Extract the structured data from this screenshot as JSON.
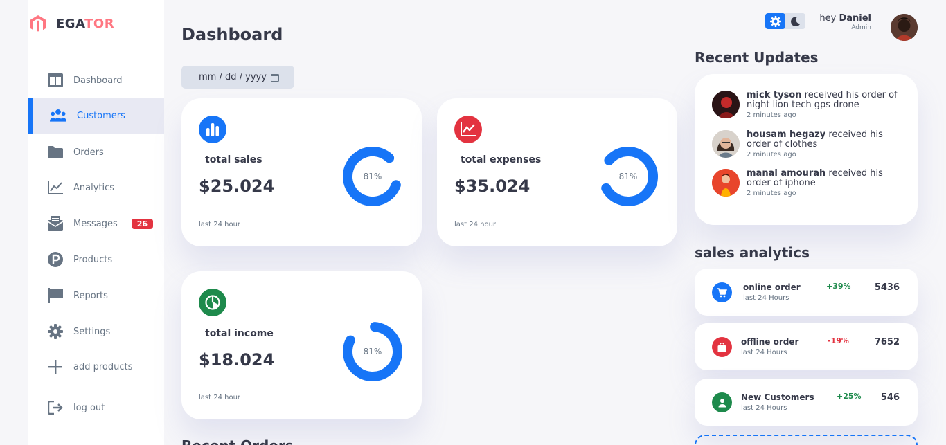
{
  "brand": {
    "name_main": "EGA",
    "name_accent": "TOR",
    "accent_color": "#ff7782"
  },
  "sidebar": {
    "items": [
      {
        "label": "Dashboard",
        "icon": "grid-icon",
        "active": false
      },
      {
        "label": "Customers",
        "icon": "people-icon",
        "active": true
      },
      {
        "label": "Orders",
        "icon": "folder-icon",
        "active": false
      },
      {
        "label": "Analytics",
        "icon": "line-chart-icon",
        "active": false
      },
      {
        "label": "Messages",
        "icon": "mail-icon",
        "active": false,
        "badge": "26"
      },
      {
        "label": "Products",
        "icon": "product-icon",
        "active": false
      },
      {
        "label": "Reports",
        "icon": "flag-icon",
        "active": false
      },
      {
        "label": "Settings",
        "icon": "gear-icon",
        "active": false
      },
      {
        "label": "add products",
        "icon": "plus-icon",
        "active": false
      },
      {
        "label": "log out",
        "icon": "logout-icon",
        "active": false
      }
    ]
  },
  "main": {
    "title": "Dashboard",
    "date_placeholder": "mm / dd / yyyy",
    "recent_orders_title": "Recent Orders",
    "cards": [
      {
        "label": "total sales",
        "amount": "$25.024",
        "note": "last 24 hour",
        "percent": "81%",
        "progress": 0.81,
        "icon": "bar-chart-icon",
        "color": "#1775f7"
      },
      {
        "label": "total expenses",
        "amount": "$35.024",
        "note": "last 24 hour",
        "percent": "81%",
        "progress": 0.81,
        "icon": "trend-icon",
        "color": "#e33340"
      },
      {
        "label": "total income",
        "amount": "$18.024",
        "note": "last 24 hour",
        "percent": "81%",
        "progress": 0.81,
        "icon": "pie-icon",
        "color": "#1e8a4c"
      }
    ]
  },
  "topbar": {
    "greeting": "hey",
    "user_name": "Daniel",
    "role": "Admin",
    "theme_light_icon": "sun-gear-icon",
    "theme_dark_icon": "moon-icon"
  },
  "updates": {
    "title": "Recent Updates",
    "items": [
      {
        "name": "mick tyson",
        "text": "received his order of night lion tech gps drone",
        "time": "2 minutes ago"
      },
      {
        "name": "housam hegazy",
        "text": "received his order of clothes",
        "time": "2 minutes ago"
      },
      {
        "name": "manal amourah",
        "text": "received his order of iphone",
        "time": "2 minutes ago"
      }
    ]
  },
  "analytics": {
    "title": "sales analytics",
    "items": [
      {
        "name": "online order",
        "sub": "last 24 Hours",
        "change": "+39%",
        "value": "5436",
        "icon": "cart-icon",
        "color": "#1775f7",
        "change_color": "#1e8a4c"
      },
      {
        "name": "offline order",
        "sub": "last 24 Hours",
        "change": "-19%",
        "value": "7652",
        "icon": "bag-icon",
        "color": "#e33340",
        "change_color": "#e33340"
      },
      {
        "name": "New Customers",
        "sub": "last 24 Hours",
        "change": "+25%",
        "value": "546",
        "icon": "person-icon",
        "color": "#1e8a4c",
        "change_color": "#1e8a4c"
      }
    ]
  }
}
